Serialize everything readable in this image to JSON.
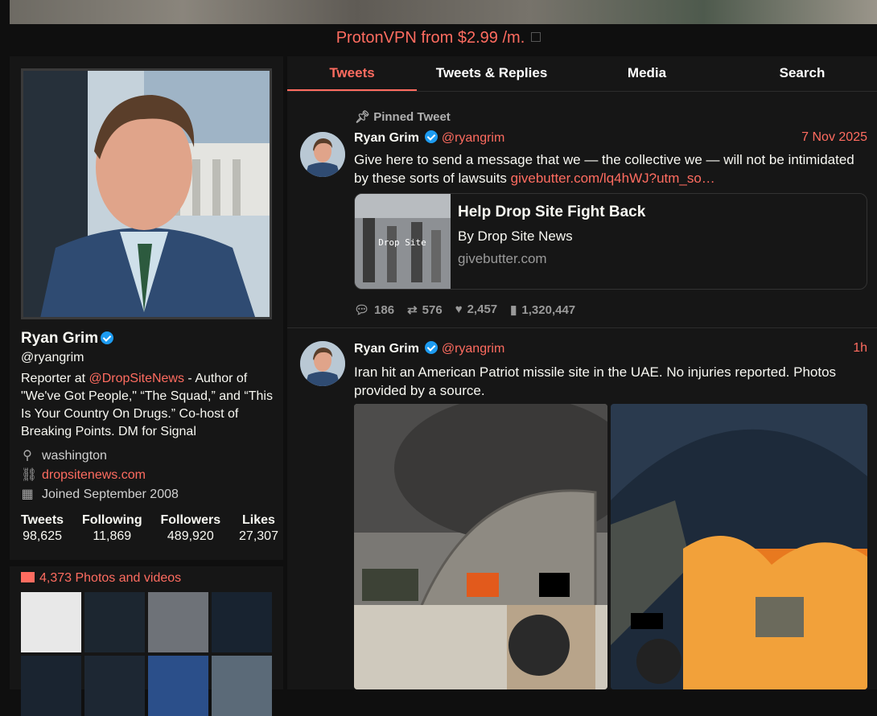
{
  "ad": {
    "text": "ProtonVPN from $2.99 /m."
  },
  "profile": {
    "name": "Ryan Grim",
    "handle": "@ryangrim",
    "bio_prefix": "Reporter at ",
    "bio_link": "@DropSiteNews",
    "bio_suffix": " - Author of \"We've Got People,\" “The Squad,” and “This Is Your Country On Drugs.” Co-host of Breaking Points. DM for Signal",
    "location": "washington",
    "website": "dropsitenews.com",
    "joined": "Joined September 2008",
    "stats": [
      {
        "label": "Tweets",
        "value": "98,625"
      },
      {
        "label": "Following",
        "value": "11,869"
      },
      {
        "label": "Followers",
        "value": "489,920"
      },
      {
        "label": "Likes",
        "value": "27,307"
      }
    ]
  },
  "media": {
    "title": "4,373 Photos and videos"
  },
  "tabs": [
    "Tweets",
    "Tweets & Replies",
    "Media",
    "Search"
  ],
  "tweets": [
    {
      "pinned_label": "Pinned Tweet",
      "name": "Ryan Grim",
      "handle": "@ryangrim",
      "date": "7 Nov 2025",
      "text": "Give here to send a message that we — the collective we — will not be intimidated by these sorts of lawsuits ",
      "link": "givebutter.com/lq4hWJ?utm_so…",
      "card": {
        "title": "Help Drop Site Fight Back",
        "by": "By Drop Site News",
        "domain": "givebutter.com",
        "overlay": "Drop Site"
      },
      "stats": {
        "replies": "186",
        "retweets": "576",
        "likes": "2,457",
        "views": "1,320,447"
      }
    },
    {
      "name": "Ryan Grim",
      "handle": "@ryangrim",
      "date": "1h",
      "text": "Iran hit an American Patriot missile site in the UAE. No injuries reported. Photos provided by a source."
    }
  ]
}
